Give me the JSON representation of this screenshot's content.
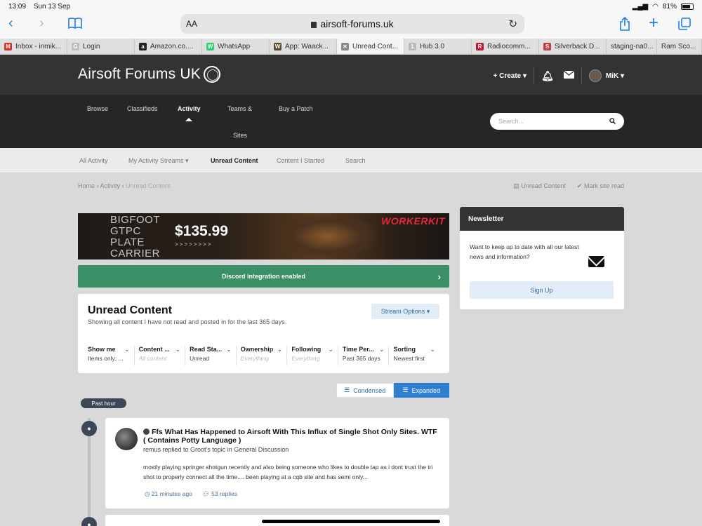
{
  "status": {
    "time": "13:09",
    "date": "Sun 13 Sep",
    "battery": "81%",
    "battery_fraction": 0.81
  },
  "browser": {
    "aa": "AA",
    "url": "airsoft-forums.uk"
  },
  "tabs": [
    {
      "label": "Inbox - inmik...",
      "fav": "M",
      "color": "#d93025"
    },
    {
      "label": "Login",
      "fav": "G",
      "color": "#bdbdbd"
    },
    {
      "label": "Amazon.co....",
      "fav": "a",
      "color": "#222222"
    },
    {
      "label": "WhatsApp",
      "fav": "W",
      "color": "#25d366"
    },
    {
      "label": "App: Waack...",
      "fav": "W",
      "color": "#5a4a2a"
    },
    {
      "label": "Unread Cont...",
      "fav": "✕",
      "color": "#888888"
    },
    {
      "label": "Hub 3.0",
      "fav": "1",
      "color": "#bbbbbb"
    },
    {
      "label": "Radiocomm...",
      "fav": "R",
      "color": "#c0182f"
    },
    {
      "label": "Silverback D...",
      "fav": "S",
      "color": "#c33b3b"
    },
    {
      "label": "staging-na0...",
      "fav": "",
      "color": "#dfdfdf"
    },
    {
      "label": "Ram Sco...",
      "fav": "",
      "color": "#dfdfdf"
    }
  ],
  "site": {
    "logo": "Airsoft Forums UK",
    "create": "Create",
    "user": "MiK"
  },
  "nav": {
    "items": [
      "Browse",
      "Classifieds",
      "Activity",
      "Teams &",
      "Sites",
      "Buy a Patch"
    ],
    "search_placeholder": "Search..."
  },
  "subnav": [
    "All Activity",
    "My Activity Streams",
    "Unread Content",
    "Content I Started",
    "Search"
  ],
  "breadcrumb": {
    "home": "Home",
    "activity": "Activity",
    "current": "Unread Content",
    "right_1": "Unread Content",
    "right_2": "Mark site read"
  },
  "banner": {
    "line1": "BIGFOOT",
    "line2": "GTPC",
    "line3": "PLATE",
    "line4": "CARRIER",
    "price": "$135.99",
    "arrows": ">>>>>>>>",
    "brand": "WORKERKIT"
  },
  "discord": "Discord integration enabled",
  "unread": {
    "title": "Unread Content",
    "subtitle": "Showing all content I have not read and posted in for the last 365 days.",
    "stream_options": "Stream Options",
    "filters": [
      {
        "label": "Show me",
        "value": "Items only; ...",
        "muted": false
      },
      {
        "label": "Content ...",
        "value": "All content",
        "muted": true
      },
      {
        "label": "Read Sta...",
        "value": "Unread",
        "muted": false
      },
      {
        "label": "Ownership",
        "value": "Everything",
        "muted": true
      },
      {
        "label": "Following",
        "value": "Everything",
        "muted": true
      },
      {
        "label": "Time Per...",
        "value": "Past 365 days",
        "muted": false
      },
      {
        "label": "Sorting",
        "value": "Newest first",
        "muted": false
      }
    ]
  },
  "view": {
    "condensed": "Condensed",
    "expanded": "Expanded"
  },
  "timeline": {
    "group": "Past hour"
  },
  "post": {
    "title": "Ffs What Has Happened to Airsoft With This Influx of Single Shot Only Sites. WTF ( Contains Potty Language )",
    "meta": "remus replied to Groot's topic in General Discussion",
    "excerpt": "mostly playing springer shotgun recently and also being someone who likes to double tap as i dont trust the tri shot to properly connect all the time.... been playing at a cqb site and has semi only...",
    "time": "21 minutes ago",
    "replies": "53 replies"
  },
  "newsletter": {
    "title": "Newsletter",
    "text": "Want to keep up to date with all our latest news and information?",
    "signup": "Sign Up"
  }
}
